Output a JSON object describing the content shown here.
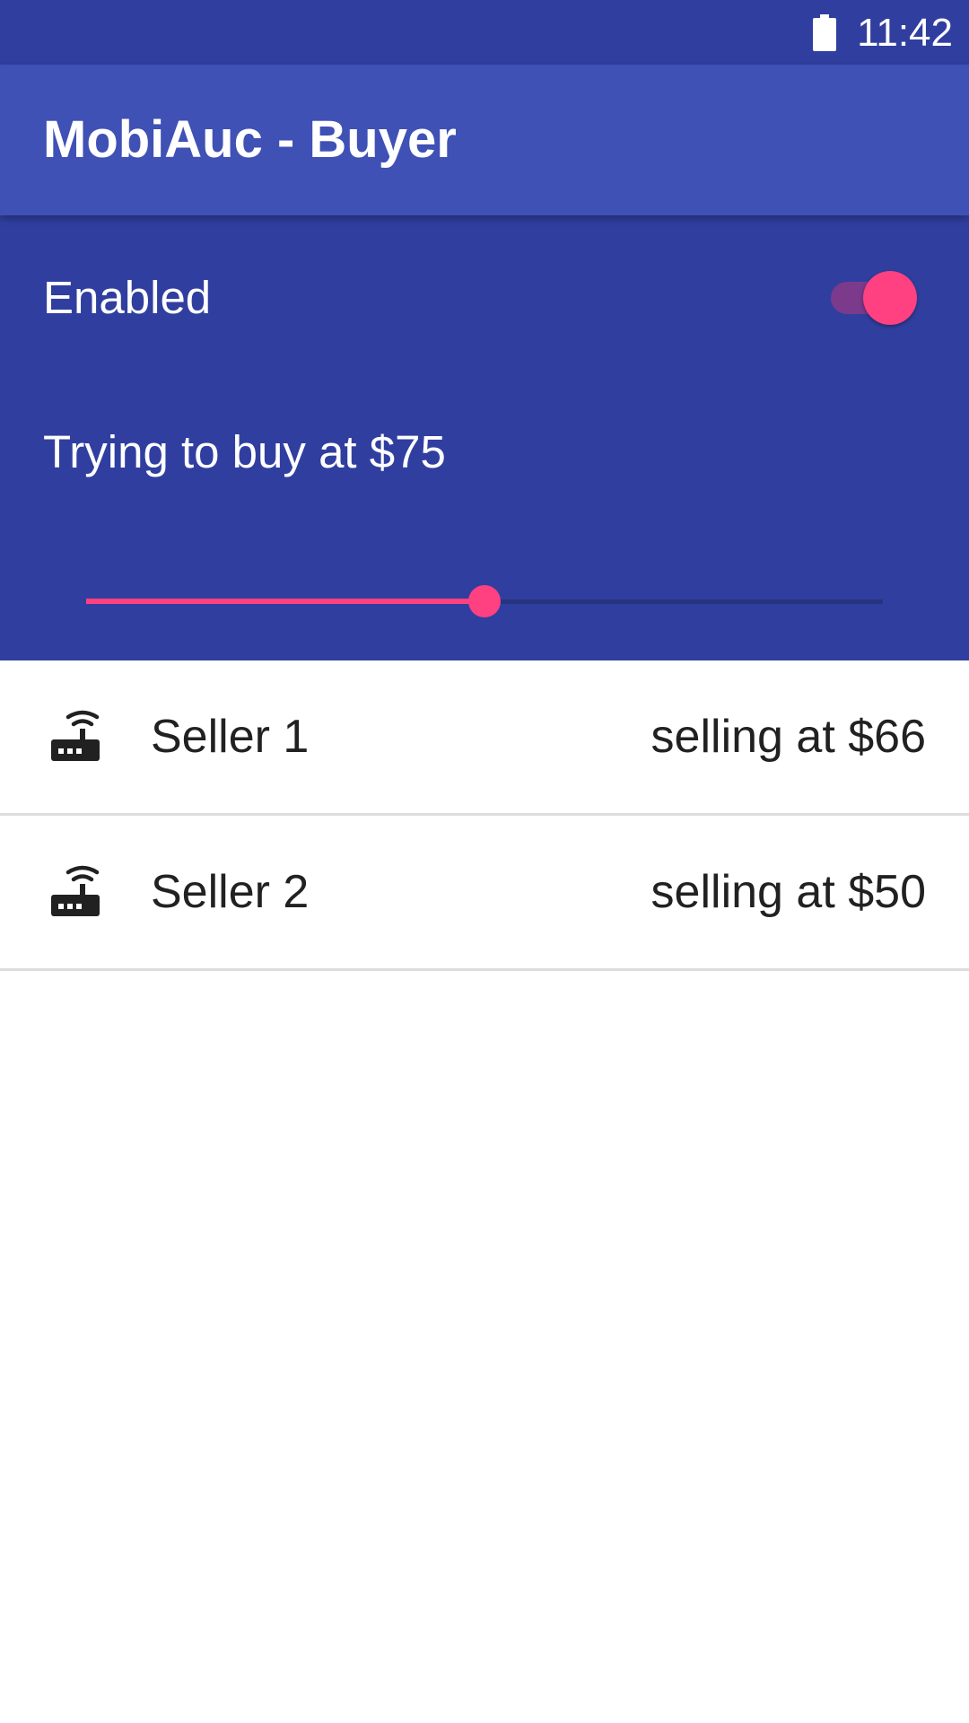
{
  "status_bar": {
    "time": "11:42",
    "battery_icon": "battery-full-icon"
  },
  "app_bar": {
    "title": "MobiAuc - Buyer"
  },
  "controls": {
    "enabled_label": "Enabled",
    "enabled_on": true,
    "price_label": "Trying to buy at $75",
    "slider_fraction": 0.5
  },
  "sellers": [
    {
      "icon": "router-icon",
      "name": "Seller 1",
      "price": "selling at $66"
    },
    {
      "icon": "router-icon",
      "name": "Seller 2",
      "price": "selling at $50"
    }
  ],
  "colors": {
    "primary": "#3f51b5",
    "primary_dark": "#303f9f",
    "accent": "#ff4081",
    "switch_track": "#7b3a8c",
    "text_dark": "#212121",
    "divider": "#dddddd"
  }
}
